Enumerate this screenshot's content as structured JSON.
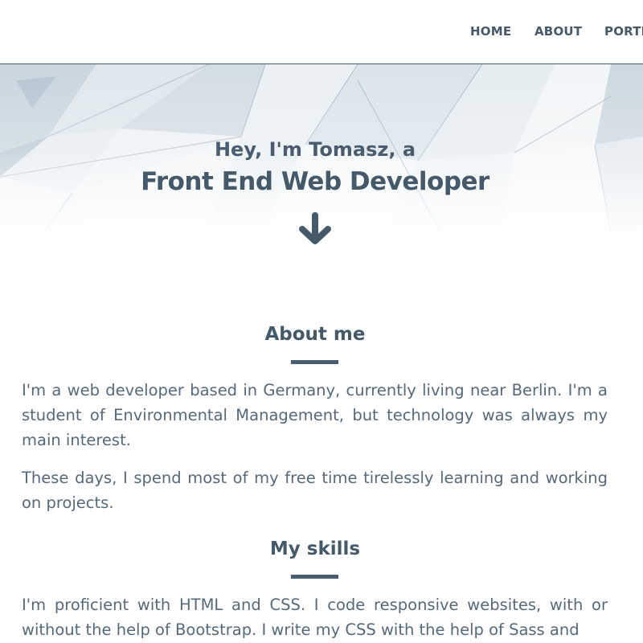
{
  "nav": {
    "items": [
      {
        "label": "HOME"
      },
      {
        "label": "ABOUT"
      },
      {
        "label": "PORTF"
      }
    ]
  },
  "hero": {
    "subtitle": "Hey, I'm Tomasz, a",
    "title": "Front End Web Developer",
    "arrow_icon": "arrow-down-icon"
  },
  "about": {
    "heading": "About me",
    "paragraphs": [
      "I'm a web developer based in Germany, currently living near Berlin. I'm a student of Environmental Management, but technology was always my main interest.",
      "These days, I spend most of my free time tirelessly learning and working on projects."
    ]
  },
  "skills": {
    "heading": "My skills",
    "paragraphs": [
      "I'm proficient with HTML and CSS. I code responsive websites, with or without the help of Bootstrap. I write my CSS with the help of Sass and"
    ]
  },
  "colors": {
    "primary": "#45596b",
    "text": "#56697a",
    "background": "#ffffff"
  }
}
